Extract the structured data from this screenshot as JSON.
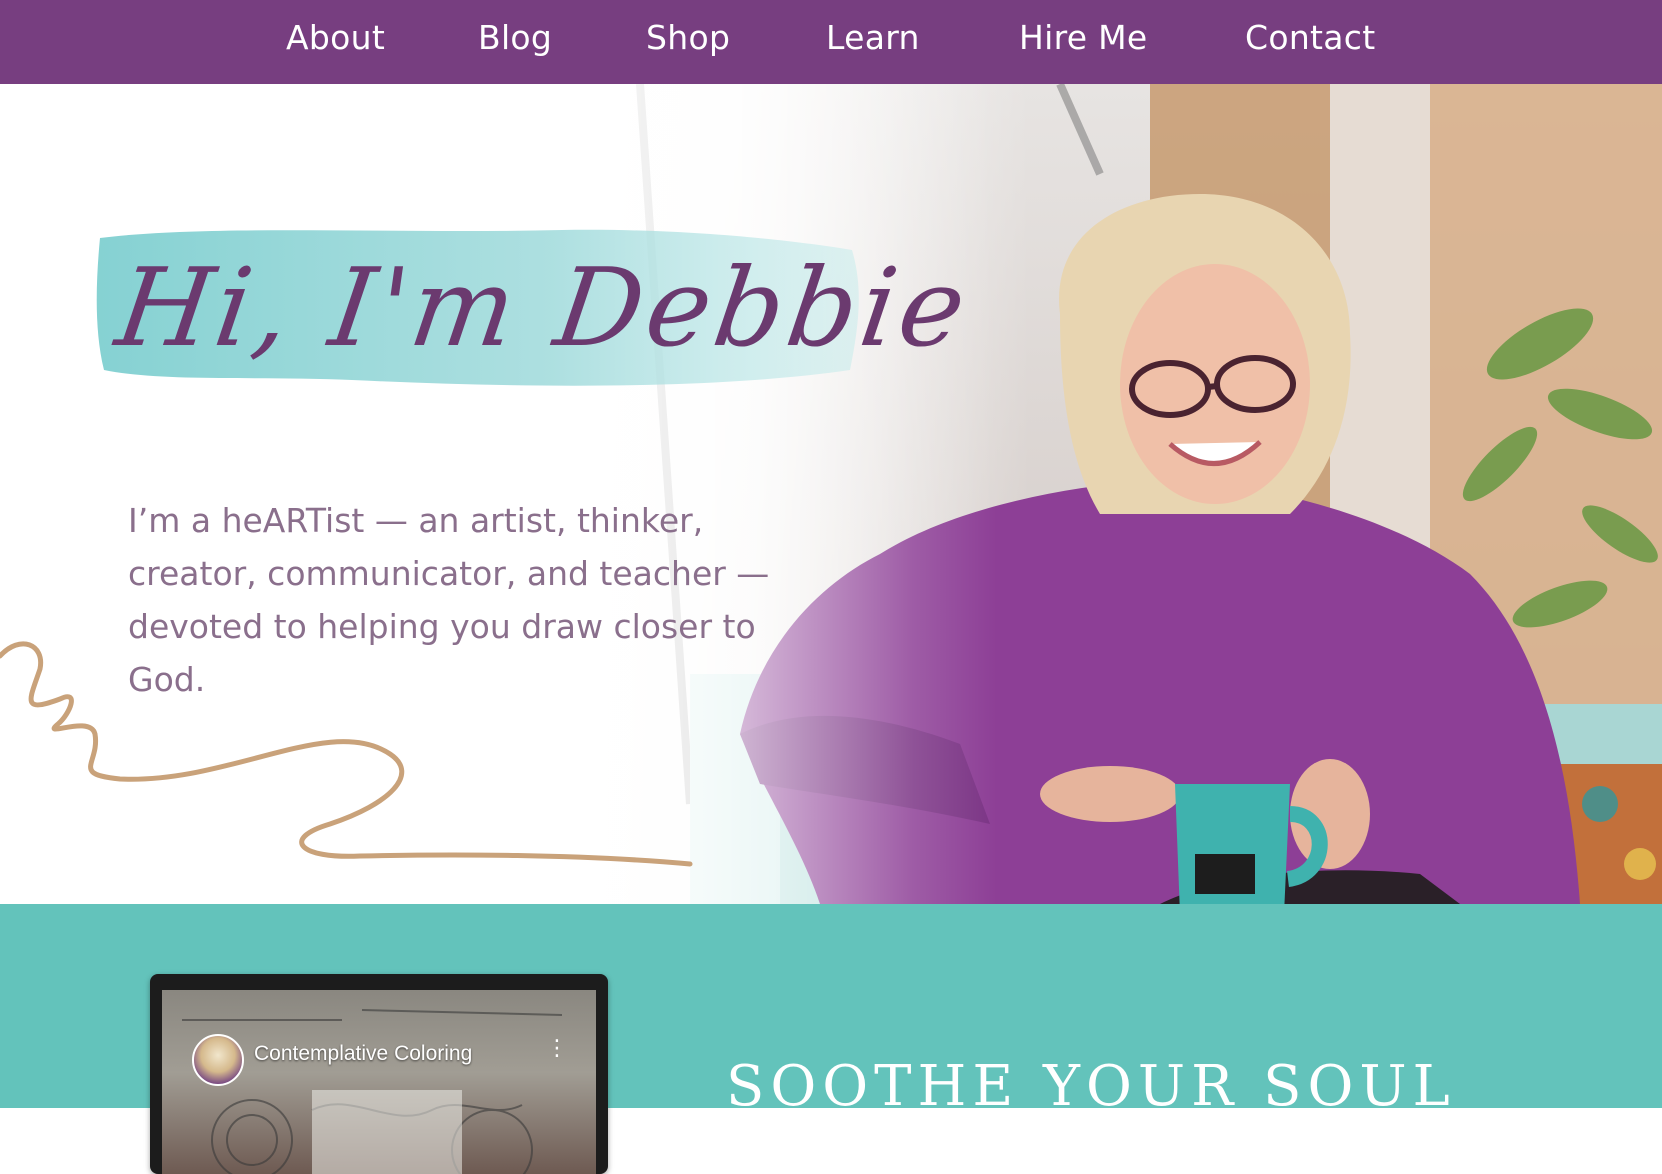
{
  "nav": {
    "items": [
      {
        "label": "About"
      },
      {
        "label": "Blog"
      },
      {
        "label": "Shop"
      },
      {
        "label": "Learn"
      },
      {
        "label": "Hire Me"
      },
      {
        "label": "Contact"
      }
    ]
  },
  "hero": {
    "script_title": "Hi, I'm Debbie",
    "intro": "I’m a heARTist — an artist, thinker, creator, communicator, and teacher — devoted to helping you draw closer to God."
  },
  "video": {
    "title": "Contemplative Coloring",
    "menu_glyph": "⋮"
  },
  "section": {
    "heading": "SOOTHE YOUR SOUL"
  },
  "colors": {
    "nav_bg": "#773e80",
    "accent_teal": "#63c3bb",
    "script_purple": "#6b3a6f",
    "squiggle_tan": "#c9a27a"
  }
}
